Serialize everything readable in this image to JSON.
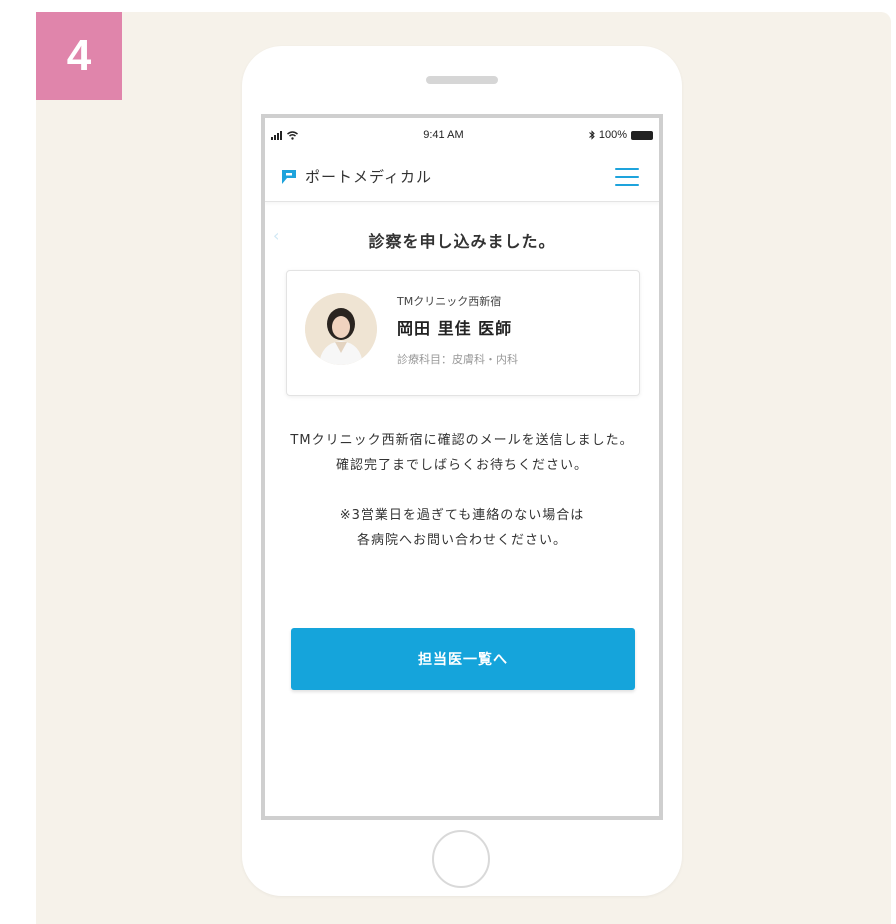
{
  "step": {
    "number": "4"
  },
  "status_bar": {
    "time": "9:41 AM",
    "battery": "100%"
  },
  "header": {
    "logo_text": "ポートメディカル"
  },
  "page": {
    "title": "診察を申し込みました。"
  },
  "doctor": {
    "clinic": "TMクリニック西新宿",
    "name": "岡田 里佳 医師",
    "department": "診療科目：皮膚科・内科"
  },
  "message": {
    "line1": "TMクリニック西新宿に確認のメールを送信しました。",
    "line2": "確認完了までしばらくお待ちください。",
    "note1": "※3営業日を過ぎても連絡のない場合は",
    "note2": "各病院へお問い合わせください。"
  },
  "cta": {
    "label": "担当医一覧へ"
  },
  "colors": {
    "badge": "#e085ab",
    "accent": "#15a4db",
    "background": "#f6f2ea"
  },
  "icons": [
    "signal-icon",
    "wifi-icon",
    "bluetooth-icon",
    "battery-icon",
    "logo-icon",
    "menu-icon",
    "back-icon"
  ]
}
